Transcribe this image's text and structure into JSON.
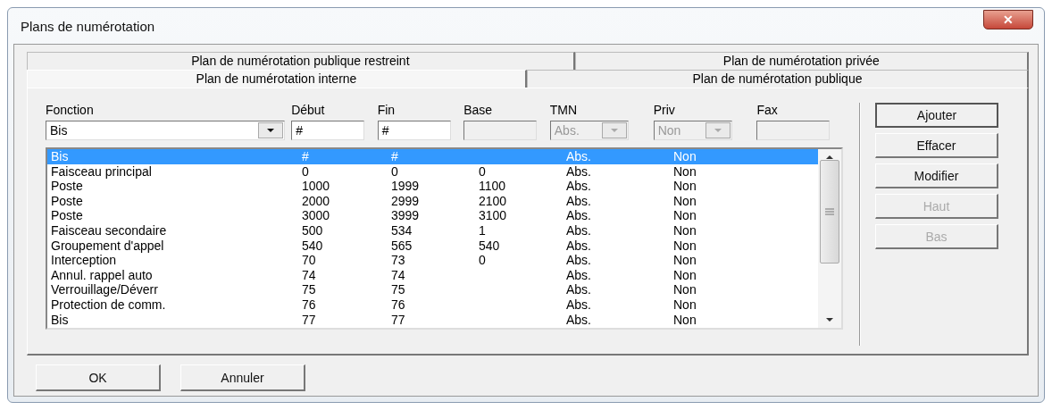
{
  "window": {
    "title": "Plans de numérotation",
    "close": "✕"
  },
  "tab_rows": [
    [
      {
        "label": "Plan de numérotation publique restreint",
        "selected": false
      },
      {
        "label": "Plan de numérotation privée",
        "selected": false
      }
    ],
    [
      {
        "label": "Plan de numérotation interne",
        "selected": true
      },
      {
        "label": "Plan de numérotation publique",
        "selected": false
      }
    ]
  ],
  "filters": [
    {
      "label": "Fonction",
      "kind": "combo",
      "value": "Bis",
      "disabled": false
    },
    {
      "label": "Début",
      "kind": "text",
      "value": "#",
      "disabled": false
    },
    {
      "label": "Fin",
      "kind": "text",
      "value": "#",
      "disabled": false
    },
    {
      "label": "Base",
      "kind": "text",
      "disabled": true
    },
    {
      "label": "TMN",
      "kind": "combo",
      "value": "Abs.",
      "disabled": true
    },
    {
      "label": "Priv",
      "kind": "combo",
      "value": "Non",
      "disabled": true
    },
    {
      "label": "Fax",
      "kind": "text",
      "disabled": true
    }
  ],
  "rows": [
    {
      "cells": [
        "Bis",
        "#",
        "#",
        "",
        "Abs.",
        "Non"
      ],
      "selected": true
    },
    {
      "cells": [
        "Faisceau principal",
        "0",
        "0",
        "0",
        "Abs.",
        "Non"
      ],
      "selected": false
    },
    {
      "cells": [
        "Poste",
        "1000",
        "1999",
        "1100",
        "Abs.",
        "Non"
      ],
      "selected": false
    },
    {
      "cells": [
        "Poste",
        "2000",
        "2999",
        "2100",
        "Abs.",
        "Non"
      ],
      "selected": false
    },
    {
      "cells": [
        "Poste",
        "3000",
        "3999",
        "3100",
        "Abs.",
        "Non"
      ],
      "selected": false
    },
    {
      "cells": [
        "Faisceau secondaire",
        "500",
        "534",
        "1",
        "Abs.",
        "Non"
      ],
      "selected": false
    },
    {
      "cells": [
        "Groupement d'appel",
        "540",
        "565",
        "540",
        "Abs.",
        "Non"
      ],
      "selected": false
    },
    {
      "cells": [
        "Interception",
        "70",
        "73",
        "0",
        "Abs.",
        "Non"
      ],
      "selected": false
    },
    {
      "cells": [
        "Annul. rappel auto",
        "74",
        "74",
        "",
        "Abs.",
        "Non"
      ],
      "selected": false
    },
    {
      "cells": [
        "Verrouillage/Déverr",
        "75",
        "75",
        "",
        "Abs.",
        "Non"
      ],
      "selected": false
    },
    {
      "cells": [
        "Protection de comm.",
        "76",
        "76",
        "",
        "Abs.",
        "Non"
      ],
      "selected": false
    },
    {
      "cells": [
        "Bis",
        "77",
        "77",
        "",
        "Abs.",
        "Non"
      ],
      "selected": false
    }
  ],
  "side_buttons": [
    {
      "label": "Ajouter",
      "disabled": false
    },
    {
      "label": "Effacer",
      "disabled": false
    },
    {
      "label": "Modifier",
      "disabled": false
    },
    {
      "label": "Haut",
      "disabled": true
    },
    {
      "label": "Bas",
      "disabled": true
    }
  ],
  "footer_buttons": [
    {
      "label": "OK"
    },
    {
      "label": "Annuler"
    }
  ]
}
